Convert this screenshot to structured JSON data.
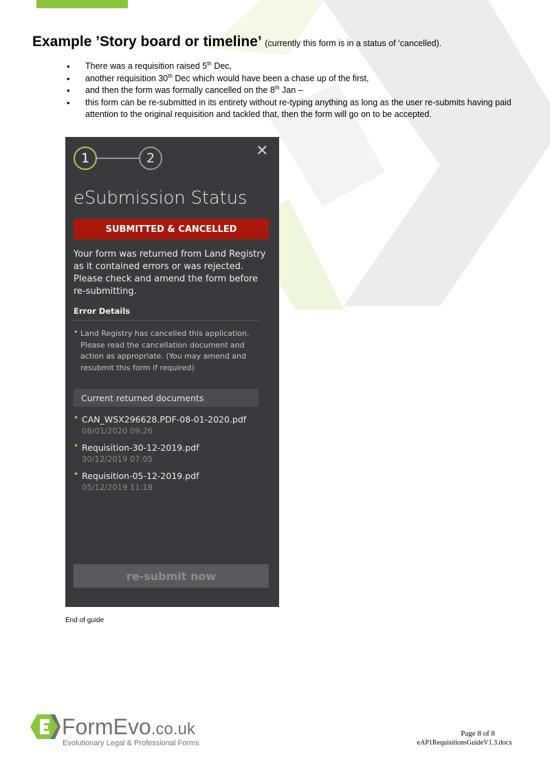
{
  "heading": {
    "title": "Example ’Story board or timeline’",
    "note": "(currently this form is in a status of ‘cancelled)."
  },
  "bullets": [
    {
      "pre": "There was a requisition raised 5",
      "sup": "th",
      "post": " Dec,"
    },
    {
      "pre": "another requisition 30",
      "sup": "th",
      "post": " Dec which would have been a chase up of the first,"
    },
    {
      "pre": "and then the form was formally cancelled on the 8",
      "sup": "th",
      "post": " Jan –"
    },
    {
      "pre": "this form can be re-submitted in its entirety without re-typing anything as long as the user re-submits having paid attention to the original requisition and tackled that, then the form will go on to be accepted.",
      "sup": "",
      "post": ""
    }
  ],
  "panel": {
    "step1": "1",
    "step2": "2",
    "close": "✕",
    "title": "eSubmission Status",
    "status": "SUBMITTED & CANCELLED",
    "message": "Your form was returned from Land Registry as it contained errors or was rejected. Please check and amend the form before re-submitting.",
    "error_heading": "Error Details",
    "error_bullet": "•",
    "error_text": "Land Registry has cancelled this application. Please read the cancellation document and action as appropriate. (You may amend and resubmit this form if required)",
    "docs_heading": "Current returned documents",
    "doc_bullet": "•",
    "documents": [
      {
        "name": "CAN_WSX296628.PDF-08-01-2020.pdf",
        "date": "08/01/2020 09:26"
      },
      {
        "name": "Requisition-30-12-2019.pdf",
        "date": "30/12/2019 07:05"
      },
      {
        "name": "Requisition-05-12-2019.pdf",
        "date": "05/12/2019 11:18"
      }
    ],
    "resubmit": "re-submit now",
    "colors": {
      "panel": "#3a3a3e",
      "status": "#a8180d",
      "accent": "#b7c84a"
    }
  },
  "end_text": "End of guide",
  "footer": {
    "logo_main": "FormEvo",
    "logo_suffix": ".co.uk",
    "tagline": "Evolutionary Legal & Professional Forms",
    "page": "Page 8 of 8",
    "filename": "eAP1RequisitionsGuideV1.3.docx",
    "logo_icon": "formevo-logo-icon",
    "logo_colors": {
      "green": "#8bc53f",
      "grey": "#707070"
    }
  }
}
